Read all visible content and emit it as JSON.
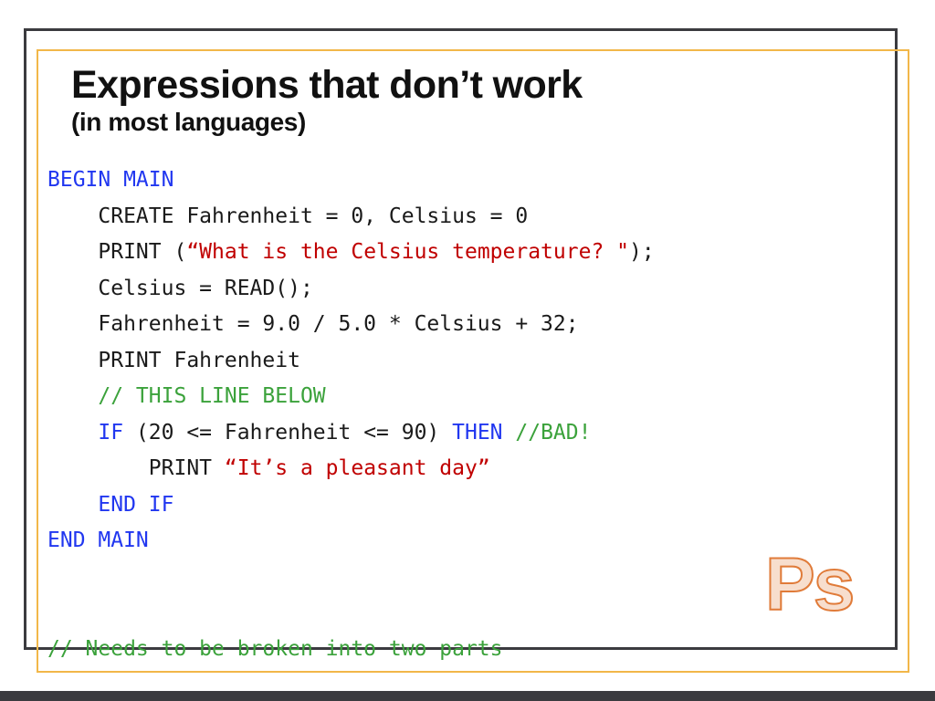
{
  "slide": {
    "title": "Expressions that don’t work",
    "subtitle": "(in most languages)",
    "logo": "Ps"
  },
  "colors": {
    "keyword": "#2137f0",
    "string": "#c00000",
    "comment": "#3ba23b",
    "plain": "#1a1a1a",
    "outer_frame": "#3b3b3f",
    "inner_frame": "#f2b749",
    "logo": "#e07b39",
    "background": "#ffffff"
  },
  "code": {
    "lines": [
      {
        "indent": 0,
        "tokens": [
          {
            "t": "BEGIN MAIN",
            "c": "kw"
          }
        ]
      },
      {
        "indent": 2,
        "tokens": [
          {
            "t": "CREATE Fahrenheit = 0, Celsius = 0",
            "c": "txt"
          }
        ]
      },
      {
        "indent": 2,
        "tokens": [
          {
            "t": "PRINT (",
            "c": "txt"
          },
          {
            "t": "“What is the Celsius temperature? \"",
            "c": "str"
          },
          {
            "t": ");",
            "c": "txt"
          }
        ]
      },
      {
        "indent": 2,
        "tokens": [
          {
            "t": "Celsius = READ();",
            "c": "txt"
          }
        ]
      },
      {
        "indent": 2,
        "tokens": [
          {
            "t": "Fahrenheit = 9.0 / 5.0 * Celsius + 32;",
            "c": "txt"
          }
        ]
      },
      {
        "indent": 2,
        "tokens": [
          {
            "t": "PRINT Fahrenheit",
            "c": "txt"
          }
        ]
      },
      {
        "indent": 2,
        "tokens": [
          {
            "t": "// THIS LINE BELOW",
            "c": "cmt"
          }
        ]
      },
      {
        "indent": 2,
        "tokens": [
          {
            "t": "IF",
            "c": "kw"
          },
          {
            "t": " (20 <= Fahrenheit <= 90) ",
            "c": "txt"
          },
          {
            "t": "THEN",
            "c": "kw"
          },
          {
            "t": " ",
            "c": "txt"
          },
          {
            "t": "//BAD!",
            "c": "cmt"
          }
        ]
      },
      {
        "indent": 4,
        "tokens": [
          {
            "t": "PRINT ",
            "c": "txt"
          },
          {
            "t": "“It’s a pleasant day”",
            "c": "str"
          }
        ]
      },
      {
        "indent": 2,
        "tokens": [
          {
            "t": "END IF",
            "c": "kw"
          }
        ]
      },
      {
        "indent": 0,
        "tokens": [
          {
            "t": "END MAIN",
            "c": "kw"
          }
        ]
      },
      {
        "indent": 0,
        "tokens": []
      },
      {
        "indent": 0,
        "tokens": []
      },
      {
        "indent": 0,
        "tokens": [
          {
            "t": "// Needs to be broken into two parts",
            "c": "cmt"
          }
        ]
      }
    ]
  }
}
